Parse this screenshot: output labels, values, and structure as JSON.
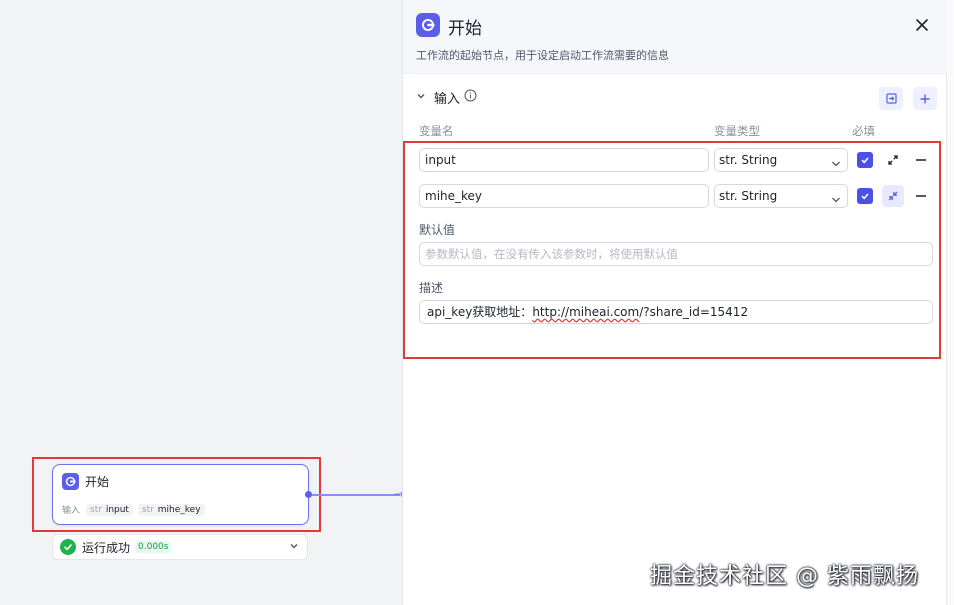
{
  "node": {
    "title": "开始",
    "io_label": "输入",
    "tags": [
      {
        "type": "str",
        "name": "input"
      },
      {
        "type": "str",
        "name": "mihe_key"
      }
    ]
  },
  "run_status": {
    "text": "运行成功",
    "time": "0.000s"
  },
  "panel": {
    "title": "开始",
    "description": "工作流的起始节点，用于设定启动工作流需要的信息",
    "section_title": "输入",
    "columns": {
      "name": "变量名",
      "type": "变量类型",
      "required": "必填"
    },
    "variables": [
      {
        "name": "input",
        "type": "str. String",
        "required": true
      },
      {
        "name": "mihe_key",
        "type": "str. String",
        "required": true
      }
    ],
    "default_label": "默认值",
    "default_placeholder": "参数默认值，在没有传入该参数时，将使用默认值",
    "desc_label": "描述",
    "desc_value_prefix": "api_key获取地址：",
    "desc_value_url": "http://miheai.com",
    "desc_value_suffix": "/?share_id=15412"
  },
  "colors": {
    "accent": "#5b5fe8",
    "highlight_red": "#e03a3a",
    "success": "#1fb34b"
  },
  "watermark": "掘金技术社区 @ 紫雨飘扬"
}
